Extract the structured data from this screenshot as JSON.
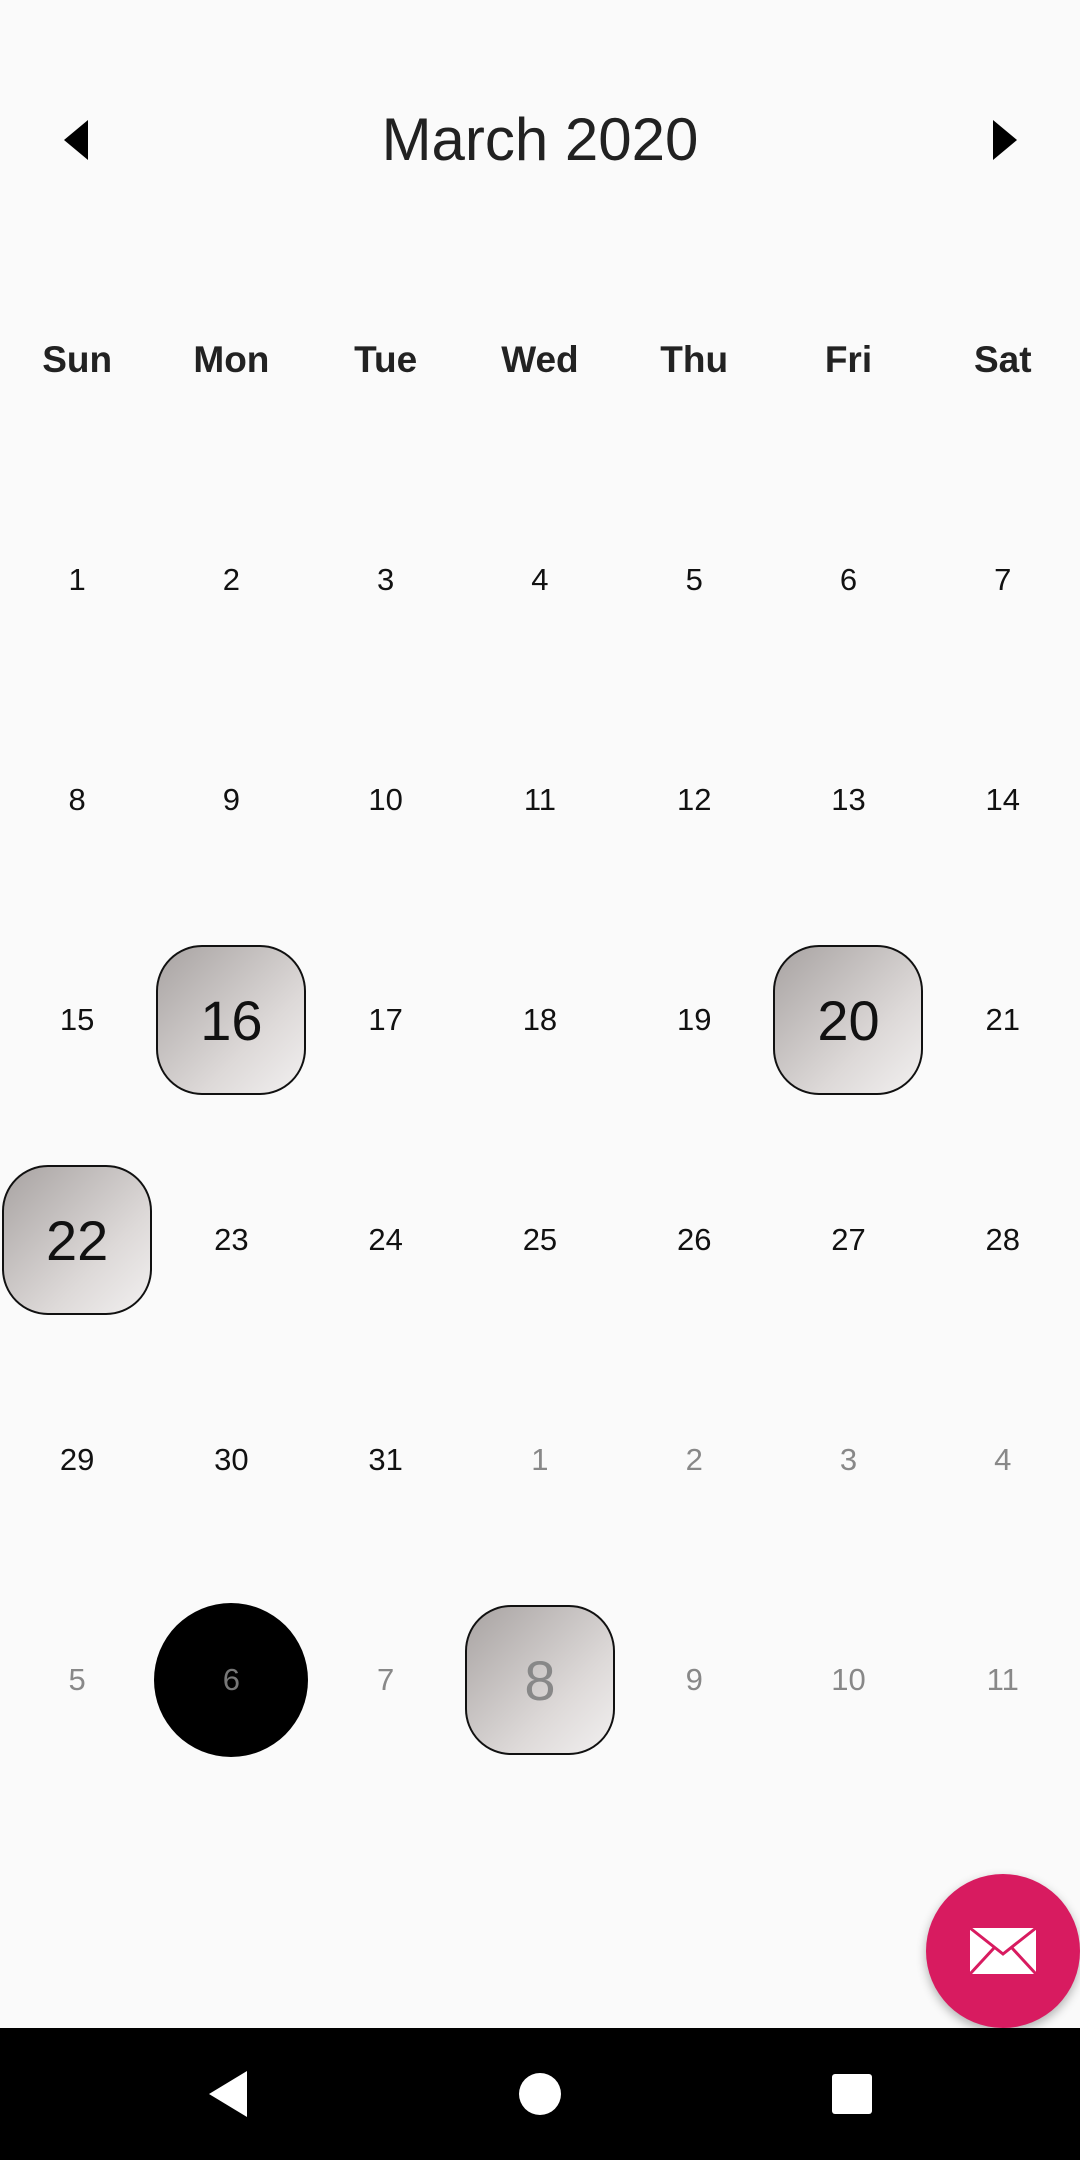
{
  "calendar": {
    "month_title": "March 2020",
    "weekdays": [
      "Sun",
      "Mon",
      "Tue",
      "Wed",
      "Thu",
      "Fri",
      "Sat"
    ],
    "weeks": [
      [
        {
          "day": "1",
          "other": false
        },
        {
          "day": "2",
          "other": false
        },
        {
          "day": "3",
          "other": false
        },
        {
          "day": "4",
          "other": false
        },
        {
          "day": "5",
          "other": false
        },
        {
          "day": "6",
          "other": false
        },
        {
          "day": "7",
          "other": false
        }
      ],
      [
        {
          "day": "8",
          "other": false
        },
        {
          "day": "9",
          "other": false
        },
        {
          "day": "10",
          "other": false
        },
        {
          "day": "11",
          "other": false
        },
        {
          "day": "12",
          "other": false
        },
        {
          "day": "13",
          "other": false
        },
        {
          "day": "14",
          "other": false
        }
      ],
      [
        {
          "day": "15",
          "other": false
        },
        {
          "day": "16",
          "other": false,
          "event": true
        },
        {
          "day": "17",
          "other": false
        },
        {
          "day": "18",
          "other": false
        },
        {
          "day": "19",
          "other": false
        },
        {
          "day": "20",
          "other": false,
          "event": true
        },
        {
          "day": "21",
          "other": false
        }
      ],
      [
        {
          "day": "22",
          "other": false,
          "event": true
        },
        {
          "day": "23",
          "other": false
        },
        {
          "day": "24",
          "other": false
        },
        {
          "day": "25",
          "other": false
        },
        {
          "day": "26",
          "other": false
        },
        {
          "day": "27",
          "other": false
        },
        {
          "day": "28",
          "other": false
        }
      ],
      [
        {
          "day": "29",
          "other": false
        },
        {
          "day": "30",
          "other": false
        },
        {
          "day": "31",
          "other": false
        },
        {
          "day": "1",
          "other": true
        },
        {
          "day": "2",
          "other": true
        },
        {
          "day": "3",
          "other": true
        },
        {
          "day": "4",
          "other": true
        }
      ],
      [
        {
          "day": "5",
          "other": true
        },
        {
          "day": "6",
          "other": true,
          "today": true
        },
        {
          "day": "7",
          "other": true
        },
        {
          "day": "8",
          "other": true,
          "event": true
        },
        {
          "day": "9",
          "other": true
        },
        {
          "day": "10",
          "other": true
        },
        {
          "day": "11",
          "other": true
        }
      ]
    ]
  },
  "icons": {
    "prev": "triangle-left-icon",
    "next": "triangle-right-icon",
    "fab": "envelope-icon",
    "back": "back-icon",
    "home": "home-icon",
    "recent": "recent-apps-icon"
  },
  "colors": {
    "fab": "#d81b60",
    "today_marker": "#000000",
    "navbar": "#000000"
  }
}
